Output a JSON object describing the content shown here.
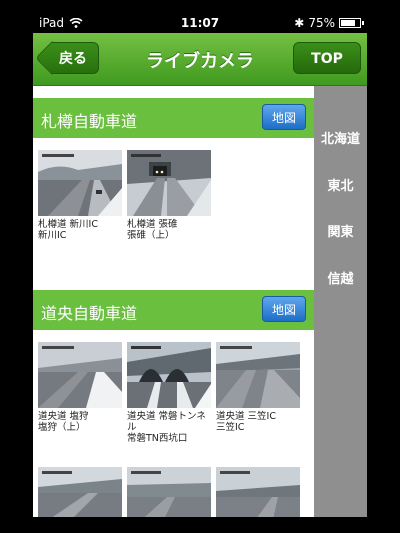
{
  "status": {
    "device": "iPad",
    "time": "11:07",
    "battery_percent": "75%",
    "battery_level": 0.75
  },
  "nav": {
    "back": "戻る",
    "title": "ライブカメラ",
    "top": "TOP"
  },
  "sections": [
    {
      "title": "札樽自動車道",
      "map": "地図",
      "cameras": [
        {
          "line1": "札樽道 新川IC",
          "line2": "新川IC"
        },
        {
          "line1": "札樽道 張碓",
          "line2": "張碓（上）"
        }
      ]
    },
    {
      "title": "道央自動車道",
      "map": "地図",
      "cameras": [
        {
          "line1": "道央道 塩狩",
          "line2": "塩狩（上）"
        },
        {
          "line1": "道央道 常磐トンネル",
          "line2": "常磐TN西坑口"
        },
        {
          "line1": "道央道 三笠IC",
          "line2": "三笠IC"
        }
      ]
    }
  ],
  "regions": [
    "北海道",
    "東北",
    "関東",
    "信越"
  ]
}
